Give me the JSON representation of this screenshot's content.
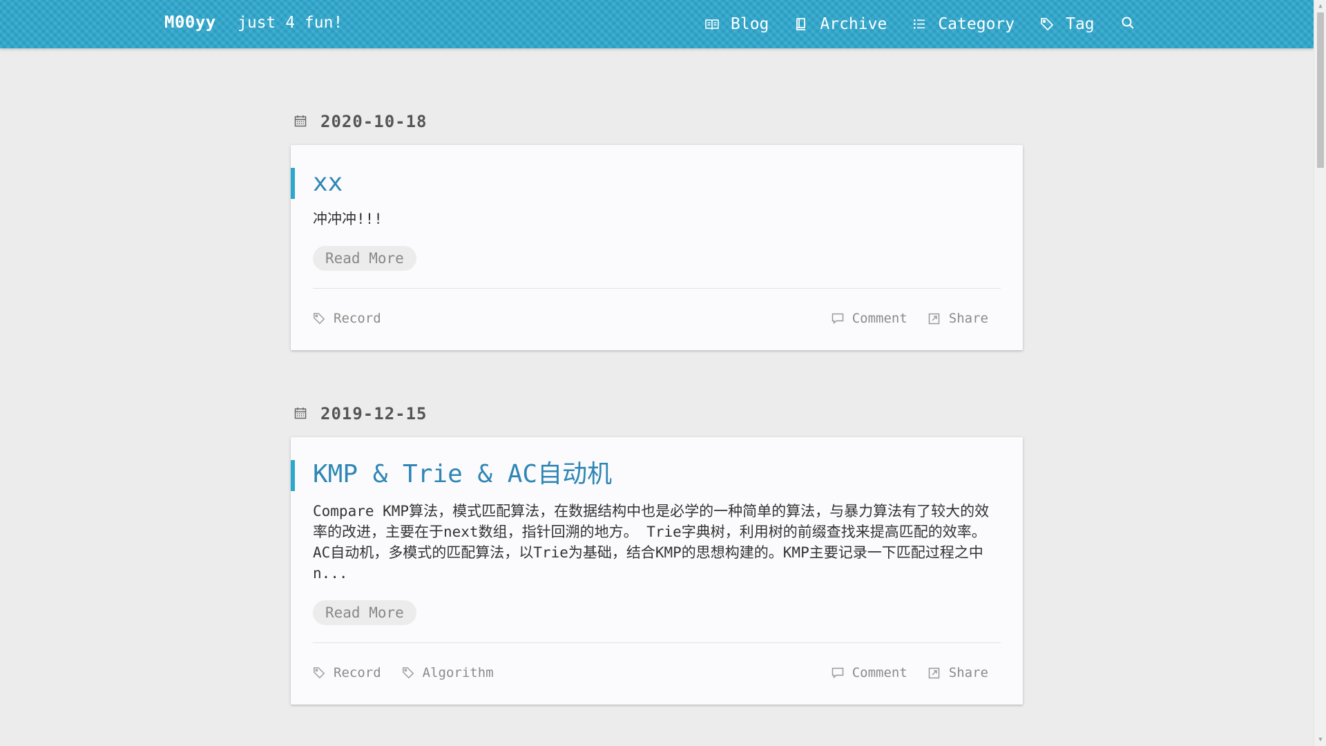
{
  "header": {
    "brand": "M00yy",
    "tagline": "just 4 fun!",
    "nav": [
      {
        "label": "Blog",
        "icon": "book-open-icon"
      },
      {
        "label": "Archive",
        "icon": "book-icon"
      },
      {
        "label": "Category",
        "icon": "list-icon"
      },
      {
        "label": "Tag",
        "icon": "tag-icon"
      }
    ],
    "search_icon": "search-icon"
  },
  "posts": [
    {
      "date": "2020-10-18",
      "title": "xx",
      "excerpt": "冲冲冲!!!",
      "read_more": "Read More",
      "tags": [
        "Record"
      ],
      "comment_label": "Comment",
      "share_label": "Share"
    },
    {
      "date": "2019-12-15",
      "title": "KMP & Trie & AC自动机",
      "excerpt_lines": [
        "Compare KMP算法，模式匹配算法，在数据结构中也是必学的一种简单的算法，与暴力算法有了较大的效",
        "率的改进，主要在于next数组，指针回溯的地方。 Trie字典树，利用树的前缀查找来提高匹配的效率。",
        "AC自动机，多模式的匹配算法，以Trie为基础，结合KMP的思想构建的。KMP主要记录一下匹配过程之中",
        "n..."
      ],
      "read_more": "Read More",
      "tags": [
        "Record",
        "Algorithm"
      ],
      "comment_label": "Comment",
      "share_label": "Share"
    }
  ],
  "colors": {
    "accent": "#2ea7cc",
    "title": "#2e86b5",
    "background": "#ececec"
  }
}
